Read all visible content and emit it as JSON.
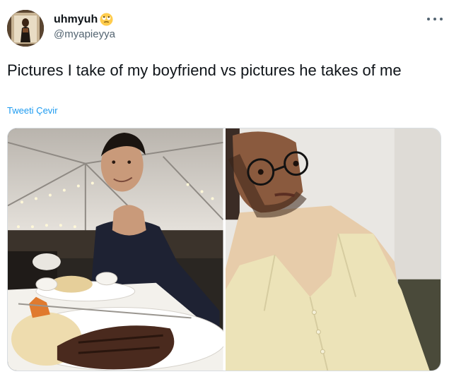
{
  "author": {
    "display_name": "uhmyuh",
    "handle": "@myapieyya",
    "emoji_icon": "rolling-eyes-emoji-icon"
  },
  "tweet": {
    "text": "Pictures I take of my boyfriend vs pictures he takes of me",
    "translate_label": "Tweeti Çevir"
  },
  "colors": {
    "link": "#1d9bf0",
    "secondary_text": "#536471",
    "primary_text": "#0f1419"
  },
  "icons": {
    "more": "more-options-icon"
  }
}
